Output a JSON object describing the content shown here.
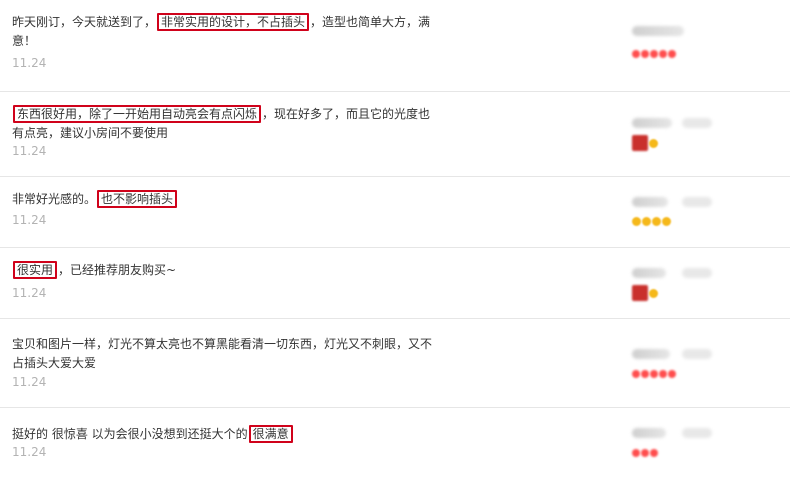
{
  "reviews": [
    {
      "before": "昨天刚订，今天就送到了，",
      "highlight": "非常实用的设计，不占插头",
      "after": "，造型也简单大方，满意！",
      "date": "11.24"
    },
    {
      "before": "",
      "highlight": "东西很好用，除了一开始用自动亮会有点闪烁",
      "after": "，现在好多了，而且它的光度也有点亮，建议小房间不要使用",
      "date": "11.24"
    },
    {
      "before": "非常好光感的。",
      "highlight": "也不影响插头",
      "after": "",
      "date": "11.24"
    },
    {
      "before": "",
      "highlight": "很实用",
      "after": "，已经推荐朋友购买~",
      "date": "11.24"
    },
    {
      "before": "宝贝和图片一样，灯光不算太亮也不算黑能看清一切东西，灯光又不刺眼，又不占插头大爱大爱",
      "highlight": "",
      "after": "",
      "date": "11.24"
    },
    {
      "before": "挺好的 很惊喜 以为会很小没想到还挺大个的",
      "highlight": "很满意",
      "after": "",
      "date": "11.24"
    }
  ],
  "colors": {
    "highlight_border": "#d0021b",
    "date_text": "#b3b3b3",
    "divider": "#e6e6e6"
  }
}
